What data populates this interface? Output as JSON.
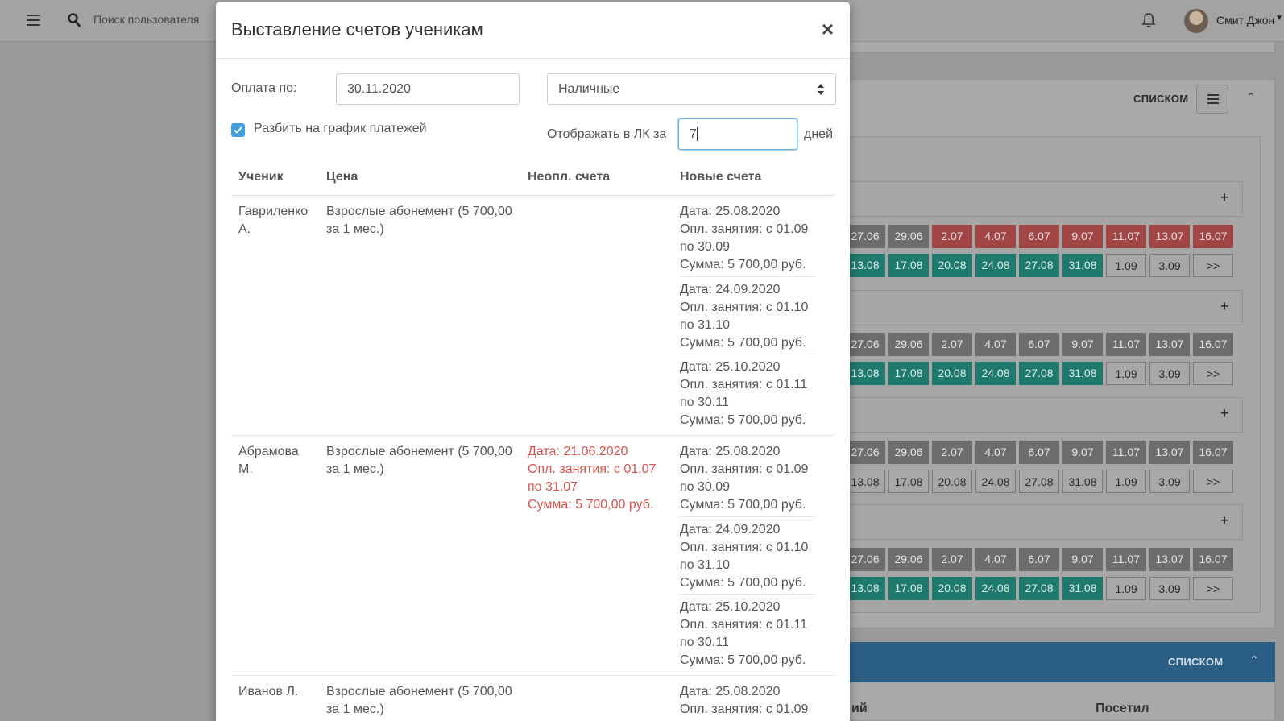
{
  "topbar": {
    "search_placeholder": "Поиск пользователя",
    "user_name": "Смит Джон"
  },
  "background": {
    "list_label": "СПИСКОМ",
    "list_label_bottom": "СПИСКОМ",
    "bottom_col_1": "ий",
    "bottom_col_2": "Посетил",
    "grid_top_row": [
      "27.06",
      "29.06",
      "2.07",
      "4.07",
      "6.07",
      "9.07",
      "11.07",
      "13.07",
      "16.07"
    ],
    "grid_bottom_row": [
      "13.08",
      "17.08",
      "20.08",
      "24.08",
      "27.08",
      "31.08",
      "1.09",
      "3.09",
      ">>"
    ]
  },
  "modal": {
    "title": "Выставление счетов ученикам",
    "pay_by_label": "Оплата по:",
    "pay_by_value": "30.11.2020",
    "payment_method": "Наличные",
    "split_label": "Разбить на график платежей",
    "show_in_lk_label": "Отображать в ЛК за",
    "days_value": "7",
    "days_label": "дней",
    "columns": {
      "student": "Ученик",
      "price": "Цена",
      "unpaid": "Неопл. счета",
      "new": "Новые счета"
    },
    "rows": [
      {
        "student_line1": "Гавриленко",
        "student_line2": "А.",
        "price_line1": "Взрослые абонемент (5 700,00",
        "price_line2": "за 1 мес.)",
        "invoices": [
          {
            "date": "Дата: 25.08.2020",
            "period1": "Опл. занятия: с 01.09",
            "period2": "по 30.09",
            "sum": "Сумма: 5 700,00 руб."
          },
          {
            "date": "Дата: 24.09.2020",
            "period1": "Опл. занятия: с 01.10",
            "period2": "по 31.10",
            "sum": "Сумма: 5 700,00 руб."
          },
          {
            "date": "Дата: 25.10.2020",
            "period1": "Опл. занятия: с 01.11",
            "period2": "по 30.11",
            "sum": "Сумма: 5 700,00 руб."
          }
        ]
      },
      {
        "student_line1": "Абрамова",
        "student_line2": "М.",
        "price_line1": "Взрослые абонемент (5 700,00",
        "price_line2": "за 1 мес.)",
        "unpaid": {
          "date": "Дата: 21.06.2020",
          "period1": "Опл. занятия: с 01.07",
          "period2": "по 31.07",
          "sum": "Сумма: 5 700,00 руб."
        },
        "invoices": [
          {
            "date": "Дата: 25.08.2020",
            "period1": "Опл. занятия: с 01.09",
            "period2": "по 30.09",
            "sum": "Сумма: 5 700,00 руб."
          },
          {
            "date": "Дата: 24.09.2020",
            "period1": "Опл. занятия: с 01.10",
            "period2": "по 31.10",
            "sum": "Сумма: 5 700,00 руб."
          },
          {
            "date": "Дата: 25.10.2020",
            "period1": "Опл. занятия: с 01.11",
            "period2": "по 30.11",
            "sum": "Сумма: 5 700,00 руб."
          }
        ]
      },
      {
        "student_line1": "Иванов Л.",
        "price_line1": "Взрослые абонемент (5 700,00",
        "price_line2": "за 1 мес.)",
        "invoices": [
          {
            "date": "Дата: 25.08.2020",
            "period1": "Опл. занятия: с 01.09"
          }
        ]
      }
    ]
  }
}
